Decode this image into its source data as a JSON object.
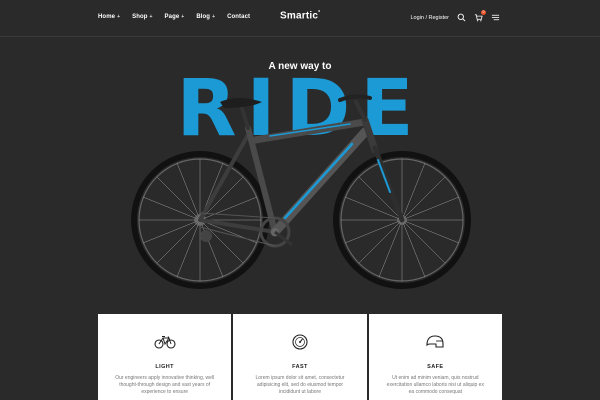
{
  "nav": {
    "links": [
      {
        "label": "Home",
        "has_dropdown": true
      },
      {
        "label": "Shop",
        "has_dropdown": true
      },
      {
        "label": "Page",
        "has_dropdown": true
      },
      {
        "label": "Blog",
        "has_dropdown": true
      },
      {
        "label": "Contact",
        "has_dropdown": false
      }
    ],
    "logo": "Smartic",
    "logo_mark": "*",
    "login_register": "Login / Register",
    "icons": [
      "search-icon",
      "cart-icon",
      "menu-icon"
    ],
    "cart_count": "0"
  },
  "hero": {
    "tagline": "A new way to",
    "headline": "RIDE"
  },
  "features": [
    {
      "icon": "bicycle-icon",
      "title": "LIGHT",
      "desc": "Our engineers apply innovative thinking, well thought-through design and vast years of experience to ensure"
    },
    {
      "icon": "speedometer-icon",
      "title": "FAST",
      "desc": "Lorem ipsum dolor sit amet, consectetur adipisicing elit, sed do eiusmod tempor incididunt ut labore"
    },
    {
      "icon": "helmet-icon",
      "title": "SAFE",
      "desc": "Ut enim ad minim veniam, quis nostrud exercitation ullamco laboris nisi ut aliquip ex ea commodo consequat"
    }
  ],
  "colors": {
    "accent": "#1c9ad6",
    "background": "#2a2a2a",
    "badge": "#e9542a"
  }
}
